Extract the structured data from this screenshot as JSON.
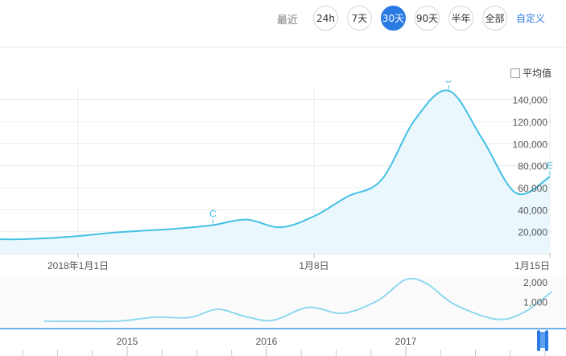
{
  "toolbar": {
    "recent_label": "最近",
    "ranges": [
      {
        "label": "24h",
        "active": false
      },
      {
        "label": "7天",
        "active": false
      },
      {
        "label": "30天",
        "active": true
      },
      {
        "label": "90天",
        "active": false
      },
      {
        "label": "半年",
        "active": false
      },
      {
        "label": "全部",
        "active": false
      }
    ],
    "custom_label": "自定义"
  },
  "avg_toggle": {
    "label": "平均值",
    "checked": false
  },
  "colors": {
    "line": "#45c0e4",
    "fill": "#eaf8fd",
    "accent": "#2a7ae4",
    "nav_line": "#8fd8ef",
    "handle": "#2a7ae4"
  },
  "chart_data": [
    {
      "type": "area",
      "title": "",
      "x_tick_labels": [
        "2018年1月1日",
        "1月8日",
        "1月15日"
      ],
      "y_tick_labels": [
        "20,000",
        "40,000",
        "60,000",
        "80,000",
        "100,000",
        "120,000",
        "140,000"
      ],
      "ylim": [
        0,
        150000
      ],
      "grid": true,
      "series": [
        {
          "x": [
            "2017-12-28",
            "2017-12-29",
            "2017-12-30",
            "2017-12-31",
            "2018-01-01",
            "2018-01-02",
            "2018-01-03",
            "2018-01-04",
            "2018-01-05",
            "2018-01-06",
            "2018-01-07",
            "2018-01-08",
            "2018-01-09",
            "2018-01-10",
            "2018-01-11",
            "2018-01-12",
            "2018-01-13",
            "2018-01-14",
            "2018-01-15"
          ],
          "values": [
            16000,
            14000,
            13000,
            14000,
            16000,
            19000,
            21000,
            23000,
            26000,
            31000,
            24000,
            34000,
            52000,
            67000,
            122000,
            148000,
            104000,
            55000,
            70000
          ]
        }
      ],
      "annotations": [
        {
          "label": "C",
          "x": "2018-01-05"
        },
        {
          "label": "D",
          "x": "2018-01-12"
        },
        {
          "label": "E",
          "x": "2018-01-15"
        }
      ]
    },
    {
      "type": "line",
      "title": "",
      "x_tick_labels": [
        "2015",
        "2016",
        "2017"
      ],
      "y_tick_labels": [
        "1,000",
        "2,000"
      ],
      "ylim": [
        0,
        2200
      ],
      "series": [
        {
          "x": [
            2014.4,
            2014.7,
            2014.95,
            2015.2,
            2015.45,
            2015.65,
            2015.85,
            2016.05,
            2016.3,
            2016.55,
            2016.8,
            2017.0,
            2017.15,
            2017.35,
            2017.65,
            2017.85,
            2018.05
          ],
          "values": [
            50,
            40,
            60,
            250,
            240,
            650,
            280,
            100,
            750,
            450,
            1100,
            2150,
            1950,
            900,
            150,
            500,
            1550
          ]
        }
      ]
    }
  ]
}
